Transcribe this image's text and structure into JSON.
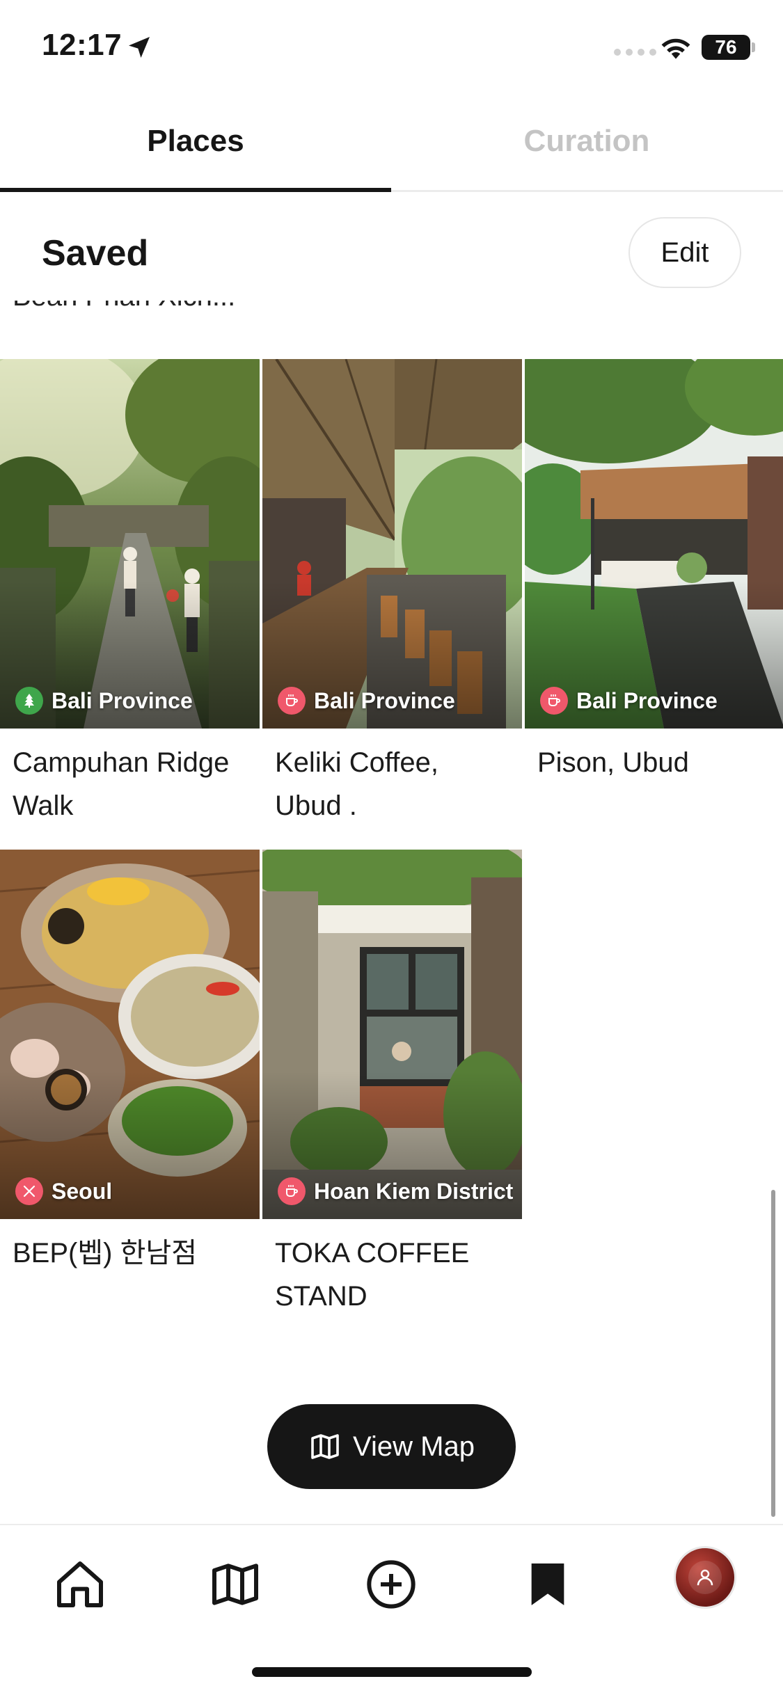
{
  "status_bar": {
    "time": "12:17",
    "battery": "76"
  },
  "tabs": [
    {
      "label": "Places",
      "active": true
    },
    {
      "label": "Curation",
      "active": false
    }
  ],
  "saved": {
    "title": "Saved",
    "edit_label": "Edit"
  },
  "partial_item_name": "Bean Phan Xich...",
  "places": [
    {
      "name": "Campuhan Ridge Walk",
      "location": "Bali Province",
      "category_icon": "tree-icon",
      "badge_color": "#3fa64b"
    },
    {
      "name": "Keliki Coffee, Ubud .",
      "location": "Bali Province",
      "category_icon": "coffee-icon",
      "badge_color": "#f0586b"
    },
    {
      "name": "Pison, Ubud",
      "location": "Bali Province",
      "category_icon": "coffee-icon",
      "badge_color": "#f0586b"
    },
    {
      "name": "BEP(벱) 한남점",
      "location": "Seoul",
      "category_icon": "restaurant-icon",
      "badge_color": "#f0586b"
    },
    {
      "name": "TOKA COFFEE STAND",
      "location": "Hoan Kiem District",
      "category_icon": "coffee-icon",
      "badge_color": "#f0586b"
    }
  ],
  "view_map_label": "View Map",
  "nav": [
    "home-icon",
    "map-icon",
    "add-icon",
    "saved-bookmark-icon",
    "profile-avatar"
  ]
}
